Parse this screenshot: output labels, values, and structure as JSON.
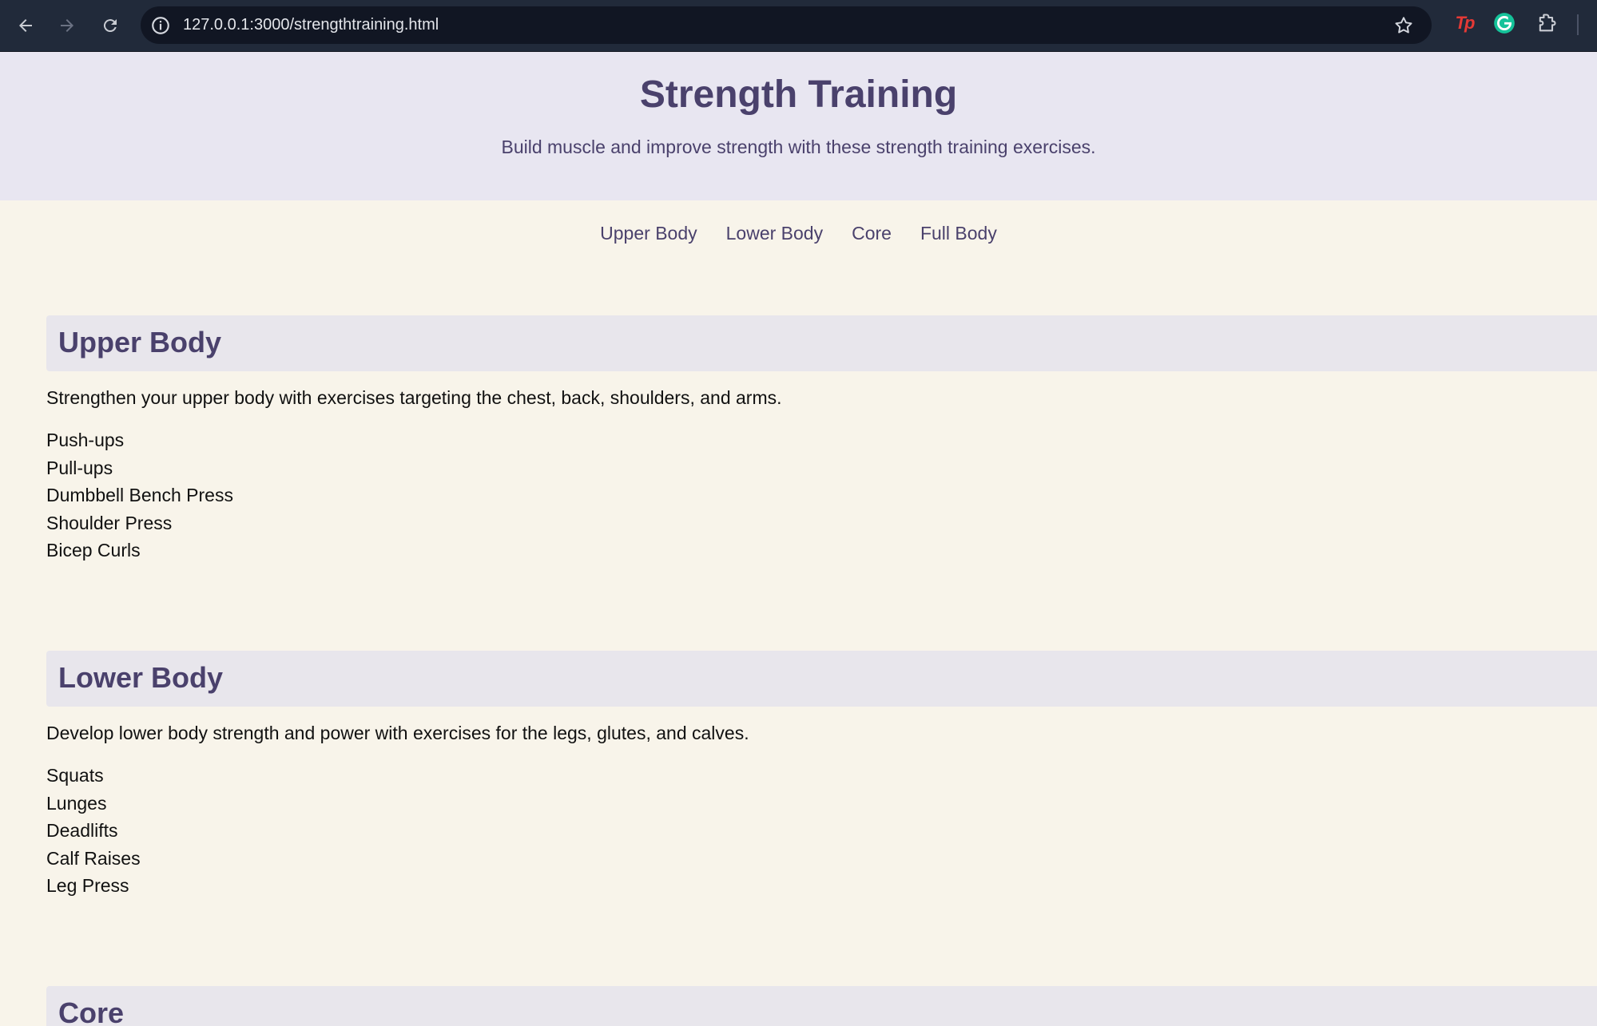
{
  "browser": {
    "url": "127.0.0.1:3000/strengthtraining.html",
    "icons": [
      "back-arrow-icon",
      "forward-arrow-icon",
      "reload-icon",
      "info-icon",
      "star-icon",
      "tp-extension-icon",
      "grammarly-icon",
      "puzzle-icon"
    ],
    "extension_tp_label": "Tp"
  },
  "header": {
    "title": "Strength Training",
    "subtitle": "Build muscle and improve strength with these strength training exercises."
  },
  "nav": [
    {
      "label": "Upper Body"
    },
    {
      "label": "Lower Body"
    },
    {
      "label": "Core"
    },
    {
      "label": "Full Body"
    }
  ],
  "sections": [
    {
      "heading": "Upper Body",
      "description": "Strengthen your upper body with exercises targeting the chest, back, shoulders, and arms.",
      "exercises": [
        "Push-ups",
        "Pull-ups",
        "Dumbbell Bench Press",
        "Shoulder Press",
        "Bicep Curls"
      ]
    },
    {
      "heading": "Lower Body",
      "description": "Develop lower body strength and power with exercises for the legs, glutes, and calves.",
      "exercises": [
        "Squats",
        "Lunges",
        "Deadlifts",
        "Calf Raises",
        "Leg Press"
      ]
    },
    {
      "heading": "Core"
    }
  ],
  "colors": {
    "page_background": "#f8f4ea",
    "header_background": "#e8e6f1",
    "section_header_background": "#e8e6ec",
    "accent_text": "#4a416c",
    "body_text": "#111111",
    "chrome_background": "#212a3a"
  }
}
